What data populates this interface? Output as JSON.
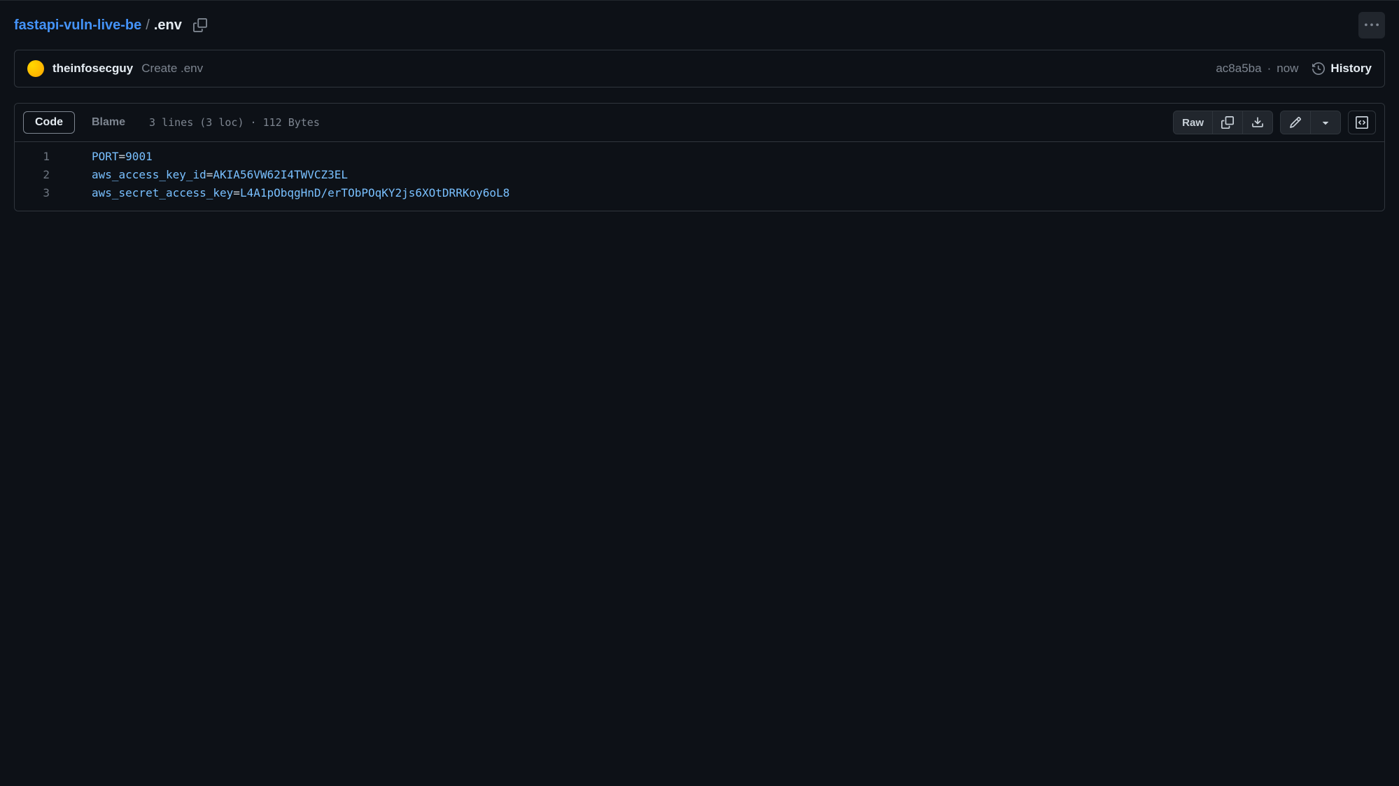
{
  "breadcrumb": {
    "repo": "fastapi-vuln-live-be",
    "separator": "/",
    "filename": ".env"
  },
  "commit": {
    "username": "theinfosecguy",
    "message": "Create .env",
    "sha": "ac8a5ba",
    "dot": "·",
    "time": "now",
    "history_label": "History"
  },
  "tabs": {
    "code": "Code",
    "blame": "Blame"
  },
  "file_info": "3 lines (3 loc) · 112 Bytes",
  "actions": {
    "raw": "Raw"
  },
  "code": {
    "lines": [
      {
        "n": "1",
        "key": "PORT",
        "eq": "=",
        "val": "9001",
        "valClass": "tok-num"
      },
      {
        "n": "2",
        "key": "aws_access_key_id",
        "eq": "=",
        "val": "AKIA56VW62I4TWVCZ3EL",
        "valClass": "tok-val"
      },
      {
        "n": "3",
        "key": "aws_secret_access_key",
        "eq": "=",
        "val": "L4A1pObqgHnD/erTObPOqKY2js6XOtDRRKoy6oL8",
        "valClass": "tok-val"
      }
    ]
  }
}
